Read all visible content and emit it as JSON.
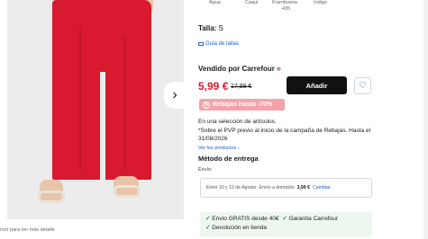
{
  "gallery": {
    "next_icon": "›",
    "zoom_hint": "rsor para ver más detalle"
  },
  "colors": {
    "swatch_labels": [
      "Agua",
      "Caqui",
      "Frambuesa",
      "435",
      "Índigo"
    ]
  },
  "size": {
    "label": "Talla:",
    "value": "S",
    "guide_label": "Guía de tallas"
  },
  "seller": {
    "label": "Vendido por Carrefour",
    "logo_icon": "carrefour-logo-icon"
  },
  "pricing": {
    "price": "5,99 €",
    "old_price": "17,99 €",
    "add_label": "Añadir",
    "favorite_icon": "♡"
  },
  "promo": {
    "badge_label": "Rebajas Hasta -70%",
    "text_line1": "En una selección de artículos.",
    "text_line2": "*Sobre el PVP previo al inicio de la campaña de Rebajas. Hasta el 31/08/2026",
    "link_label": "Ver los productos ›"
  },
  "delivery": {
    "title": "Método de entrega",
    "envio_label": "Envío:",
    "window": "Entre 10 y 12 de Agosto",
    "method": "Envío a domicilio",
    "cost": "3,99 €",
    "change_label": "Cambiar"
  },
  "perks": {
    "free_shipping": "Envío GRATIS desde 40€",
    "guarantee": "Garantía Carrefour",
    "returns": "Devolución en tienda",
    "check_icon": "✓"
  },
  "theme": {
    "accent": "#1e5bc6",
    "sale_red": "#d8192f",
    "promo_pink": "#f4a3a8",
    "perk_bg": "#eef7ef"
  }
}
